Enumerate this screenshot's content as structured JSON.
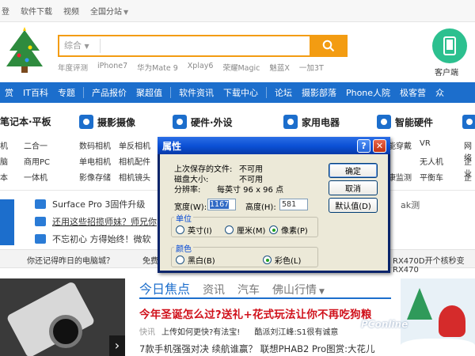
{
  "topbar": {
    "items": [
      "登",
      "软件下载",
      "视频",
      "全国分站"
    ]
  },
  "header": {
    "search_category": "综合",
    "hot_words": [
      "年度评测",
      "iPhone7",
      "华为Mate 9",
      "Xplay6",
      "荣耀Magic",
      "魅蓝X",
      "一加3T"
    ],
    "client_label": "客户端"
  },
  "nav": {
    "items": [
      "赏",
      "IT百科",
      "专题",
      "产品报价",
      "聚超值",
      "软件资讯",
      "下载中心",
      "论坛",
      "摄影部落",
      "Phone人院",
      "极客营",
      "众"
    ]
  },
  "categories": [
    {
      "label": "笔记本·平板"
    },
    {
      "label": "摄影摄像"
    },
    {
      "label": "硬件·外设"
    },
    {
      "label": "家用电器"
    },
    {
      "label": "智能硬件"
    }
  ],
  "sublinks": {
    "row1": [
      "机",
      "二合一",
      "数码相机",
      "单反相机",
      "能穿戴",
      "VR",
      "网络"
    ],
    "row2": [
      "脑",
      "商用PC",
      "单电相机",
      "相机配件",
      "无人机",
      "企业"
    ],
    "row3": [
      "本",
      "一体机",
      "影像存储",
      "相机镜头",
      "康监测",
      "平衡车",
      "企"
    ]
  },
  "news": {
    "lines": [
      "Surface Pro 3固件升级",
      "还用这些招揽师妹？师兄你",
      "不忘初心 方得始终！微软"
    ],
    "right": "ak测"
  },
  "ticker": {
    "left": "你还记得昨日的电脑城？",
    "mid": "免费",
    "right": "RX470D开个核秒变RX470"
  },
  "main": {
    "tabs": [
      "今日焦点",
      "资讯",
      "汽车",
      "佛山行情"
    ],
    "headline": "今年圣诞怎么过?送礼+花式玩法让你不再吃狗粮",
    "flash_label": "快讯",
    "flash_items": [
      "上传如何更快?有法宝!",
      "酷派刘江峰:S1很有诚意"
    ],
    "bottom_line": "7款手机强强对决 续航谁赢？ 联想PHAB2 Pro图赏:大花儿"
  },
  "watermark": "PConline",
  "dialog": {
    "title": "属性",
    "info": [
      {
        "label": "上次保存的文件:",
        "value": "不可用"
      },
      {
        "label": "磁盘大小:",
        "value": "不可用"
      },
      {
        "label": "分辨率:",
        "value": "每英寸 96 x 96 点"
      }
    ],
    "buttons": {
      "ok": "确定",
      "cancel": "取消",
      "default": "默认值(D)"
    },
    "width_label": "宽度(W):",
    "width_value": "1167",
    "height_label": "高度(H):",
    "height_value": "581",
    "units_title": "单位",
    "units": [
      {
        "label": "英寸(I)",
        "selected": false
      },
      {
        "label": "厘米(M)",
        "selected": false
      },
      {
        "label": "像素(P)",
        "selected": true
      }
    ],
    "color_title": "颜色",
    "colors": [
      {
        "label": "黑白(B)",
        "selected": false
      },
      {
        "label": "彩色(L)",
        "selected": true
      }
    ]
  },
  "colors": {
    "brand_blue": "#1c6ecc",
    "search_orange": "#f39c12",
    "headline_red": "#d0111b",
    "xp_title_blue": "#0a4fd4"
  }
}
